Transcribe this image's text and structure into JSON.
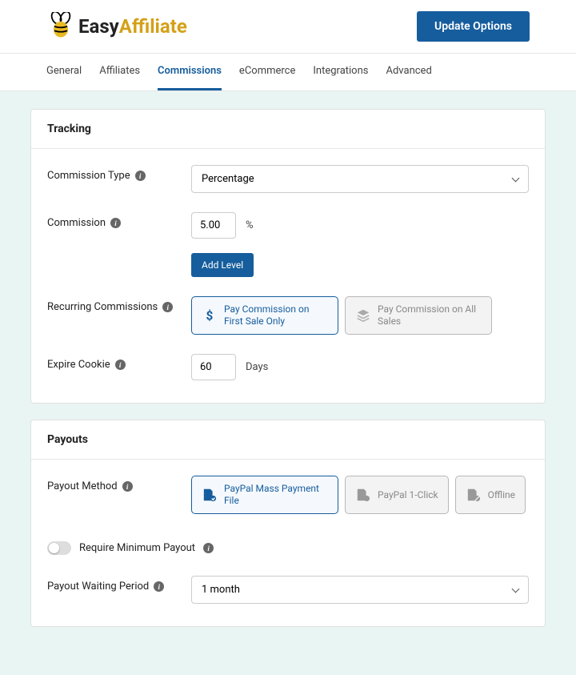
{
  "header": {
    "brand_easy": "Easy",
    "brand_aff": "Affiliate",
    "update_btn": "Update Options"
  },
  "tabs": [
    "General",
    "Affiliates",
    "Commissions",
    "eCommerce",
    "Integrations",
    "Advanced"
  ],
  "tracking": {
    "title": "Tracking",
    "commission_type_label": "Commission Type",
    "commission_type_value": "Percentage",
    "commission_label": "Commission",
    "commission_value": "5.00",
    "commission_suffix": "%",
    "add_level": "Add Level",
    "recurring_label": "Recurring Commissions",
    "recurring_first": "Pay Commission on First Sale Only",
    "recurring_all": "Pay Commission on All Sales",
    "cookie_label": "Expire Cookie",
    "cookie_value": "60",
    "cookie_suffix": "Days"
  },
  "payouts": {
    "title": "Payouts",
    "method_label": "Payout Method",
    "opt_mass": "PayPal Mass Payment File",
    "opt_1click": "PayPal 1-Click",
    "opt_offline": "Offline",
    "minpayout_label": "Require Minimum Payout",
    "waiting_label": "Payout Waiting Period",
    "waiting_value": "1 month"
  }
}
